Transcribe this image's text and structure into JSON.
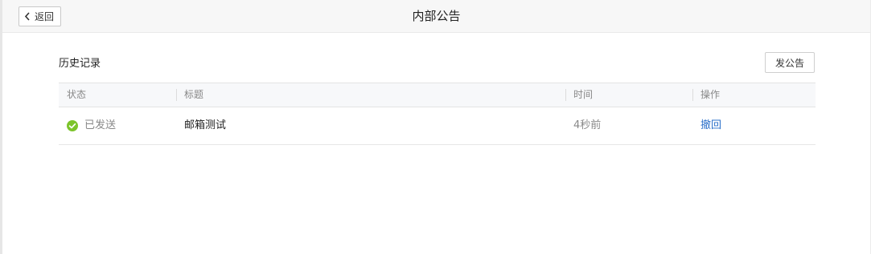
{
  "header": {
    "back_label": "返回",
    "title": "内部公告"
  },
  "section": {
    "title": "历史记录",
    "publish_label": "发公告"
  },
  "table": {
    "columns": [
      "状态",
      "标题",
      "时间",
      "操作"
    ],
    "rows": [
      {
        "status": "已发送",
        "status_icon": "check-circle-icon",
        "status_color": "#7cc42a",
        "title": "邮箱测试",
        "time": "4秒前",
        "action": "撤回"
      }
    ]
  },
  "colors": {
    "link": "#2a6fc9",
    "success": "#7cc42a"
  }
}
